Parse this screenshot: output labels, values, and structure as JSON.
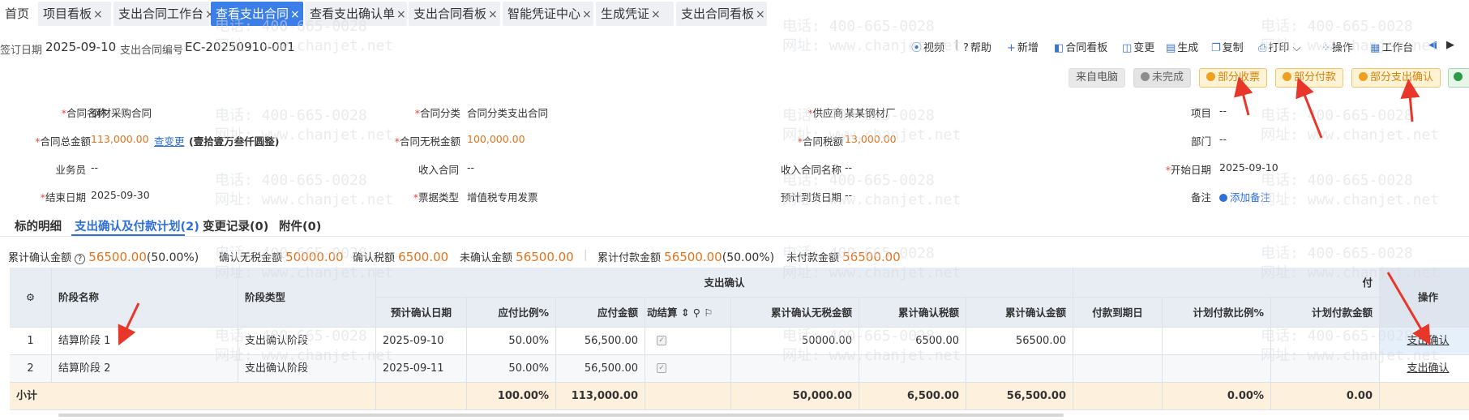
{
  "tabs": [
    {
      "label": "首页",
      "close": ""
    },
    {
      "label": "项目看板",
      "close": "×"
    },
    {
      "label": "支出合同工作台",
      "close": "×"
    },
    {
      "label": "查看支出合同",
      "close": "×"
    },
    {
      "label": "查看支出确认单",
      "close": "×"
    },
    {
      "label": "支出合同看板",
      "close": "×"
    },
    {
      "label": "智能凭证中心",
      "close": "×"
    },
    {
      "label": "生成凭证",
      "close": "×"
    },
    {
      "label": "支出合同看板",
      "close": "×"
    }
  ],
  "header": {
    "sign_date_label": "签订日期",
    "sign_date": "2025-09-10",
    "contract_no_label": "支出合同编号",
    "contract_no": "EC-20250910-001"
  },
  "toolbar": {
    "video": "视频",
    "help": "帮助",
    "add": "新增",
    "board": "合同看板",
    "change": "变更",
    "generate": "生成",
    "copy": "复制",
    "print": "打印",
    "ops": "操作",
    "workbench": "工作台"
  },
  "badges": {
    "from_pc": "来自电脑",
    "incomplete": "未完成",
    "partial_receipt": "部分收票",
    "partial_payment": "部分付款",
    "partial_confirm": "部分支出确认"
  },
  "form": {
    "contract_name_label": "合同名称",
    "contract_name": "钢材采购合同",
    "category_label": "合同分类",
    "category": "合同分类支出合同",
    "supplier_label": "供应商",
    "supplier": "某某钢材厂",
    "project_label": "项目",
    "project": "--",
    "total_label": "合同总金额",
    "total": "113,000.00",
    "change_link": "查变更",
    "total_cn": "(壹拾壹万叁仟圆整)",
    "no_tax_label": "合同无税金额",
    "no_tax": "100,000.00",
    "tax_label": "合同税额",
    "tax": "13,000.00",
    "dept_label": "部门",
    "dept": "--",
    "salesman_label": "业务员",
    "salesman": "--",
    "income_contract_label": "收入合同",
    "income_contract": "--",
    "income_contract_name_label": "收入合同名称",
    "income_contract_name": "--",
    "start_label": "开始日期",
    "start": "2025-09-10",
    "end_label": "结束日期",
    "end": "2025-09-30",
    "invoice_type_label": "票据类型",
    "invoice_type": "增值税专用发票",
    "arrival_label": "预计到货日期",
    "arrival": "--",
    "remark_label": "备注",
    "remark_link": "添加备注"
  },
  "subtabs": [
    {
      "label": "标的明细"
    },
    {
      "label": "支出确认及付款计划(2)"
    },
    {
      "label": "变更记录(0)"
    },
    {
      "label": "附件(0)"
    }
  ],
  "summary": {
    "confirm_total_label": "累计确认金额",
    "confirm_total": "56500.00",
    "confirm_pct": "(50.00%)",
    "confirm_notax_label": "确认无税金额",
    "confirm_notax": "50000.00",
    "confirm_tax_label": "确认税额",
    "confirm_tax": "6500.00",
    "unconfirmed_label": "未确认金额",
    "unconfirmed": "56500.00",
    "paid_total_label": "累计付款金额",
    "paid_total": "56500.00",
    "paid_pct": "(50.00%)",
    "unpaid_label": "未付款金额",
    "unpaid": "56500.00"
  },
  "table": {
    "group_confirm": "支出确认",
    "group_pay": "付",
    "headers": {
      "stage_name": "阶段名称",
      "stage_type": "阶段类型",
      "plan_date": "预计确认日期",
      "pay_ratio": "应付比例%",
      "pay_amount": "应付金额",
      "auto_settle": "动结算",
      "confirm_notax": "累计确认无税金额",
      "confirm_tax": "累计确认税额",
      "confirm_amount": "累计确认金额",
      "due_date": "付款到期日",
      "plan_ratio": "计划付款比例%",
      "plan_amount": "计划付款金额",
      "op": "操作"
    },
    "rows": [
      {
        "idx": "1",
        "name": "结算阶段 1",
        "type": "支出确认阶段",
        "date": "2025-09-10",
        "ratio": "50.00%",
        "amount": "56,500.00",
        "notax": "50000.00",
        "tax": "6500.00",
        "total": "56500.00",
        "op": "支出确认"
      },
      {
        "idx": "2",
        "name": "结算阶段 2",
        "type": "支出确认阶段",
        "date": "2025-09-11",
        "ratio": "50.00%",
        "amount": "56,500.00",
        "notax": "",
        "tax": "",
        "total": "",
        "op": "支出确认"
      }
    ],
    "subtotal": {
      "label": "小计",
      "ratio": "100.00%",
      "amount": "113,000.00",
      "notax": "50,000.00",
      "tax": "6,500.00",
      "total": "56,500.00",
      "plan_ratio": "0.00%",
      "plan_amount": "0.00"
    }
  },
  "watermark": {
    "phone": "电话: 400-665-0028",
    "site": "网址: www.chanjet.net"
  },
  "colors": {
    "accent": "#3b7ee8",
    "orange": "#e2731c",
    "arrow": "#e8372a"
  }
}
